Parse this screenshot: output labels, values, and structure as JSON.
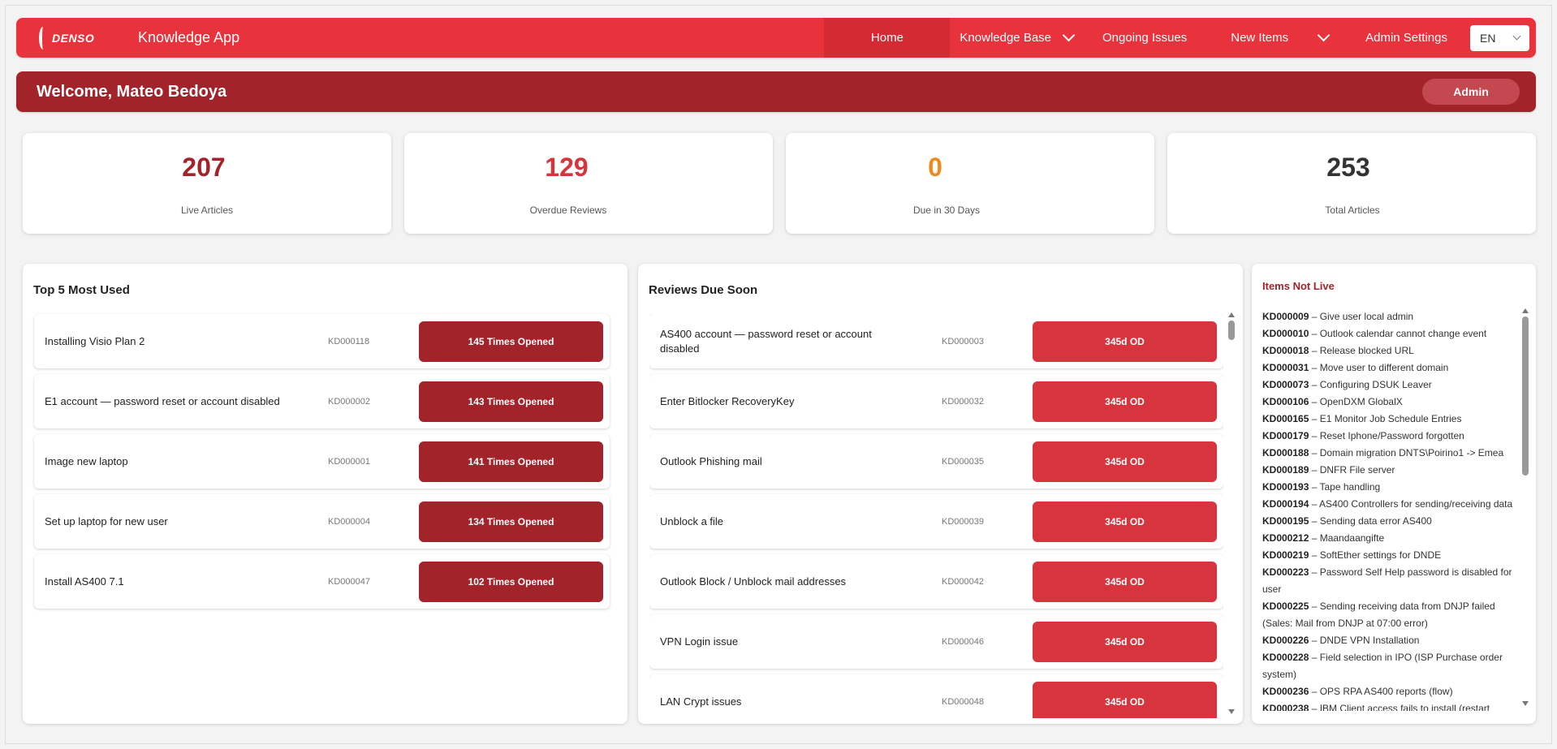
{
  "nav": {
    "logo_text": "DENSO",
    "app_title": "Knowledge App",
    "items": [
      "Home",
      "Knowledge Base",
      "Ongoing Issues",
      "New Items",
      "Admin Settings"
    ],
    "language": "EN"
  },
  "welcome": {
    "text": "Welcome, Mateo Bedoya",
    "role": "Admin"
  },
  "stats": [
    {
      "value": "207",
      "label": "Live Articles",
      "color": "#a3232b"
    },
    {
      "value": "129",
      "label": "Overdue Reviews",
      "color": "#d8343d"
    },
    {
      "value": "0",
      "label": "Due in 30 Days",
      "color": "#f0891a"
    },
    {
      "value": "253",
      "label": "Total Articles",
      "color": "#333333"
    }
  ],
  "top_used": {
    "title": "Top 5 Most Used",
    "rows": [
      {
        "title": "Installing Visio Plan 2",
        "id": "KD000118",
        "badge": "145 Times Opened"
      },
      {
        "title": "E1 account — password reset or account disabled",
        "id": "KD000002",
        "badge": "143 Times Opened"
      },
      {
        "title": "Image new laptop",
        "id": "KD000001",
        "badge": "141 Times Opened"
      },
      {
        "title": "Set up laptop for new user",
        "id": "KD000004",
        "badge": "134 Times Opened"
      },
      {
        "title": "Install AS400 7.1",
        "id": "KD000047",
        "badge": "102 Times Opened"
      }
    ]
  },
  "reviews_due": {
    "title": "Reviews Due Soon",
    "rows": [
      {
        "title": "AS400 account — password reset or account disabled",
        "id": "KD000003",
        "badge": "345d OD"
      },
      {
        "title": "Enter Bitlocker RecoveryKey",
        "id": "KD000032",
        "badge": "345d OD"
      },
      {
        "title": "Outlook Phishing mail",
        "id": "KD000035",
        "badge": "345d OD"
      },
      {
        "title": "Unblock a file",
        "id": "KD000039",
        "badge": "345d OD"
      },
      {
        "title": "Outlook Block / Unblock mail addresses",
        "id": "KD000042",
        "badge": "345d OD"
      },
      {
        "title": "VPN Login issue",
        "id": "KD000046",
        "badge": "345d OD"
      },
      {
        "title": "LAN Crypt issues",
        "id": "KD000048",
        "badge": "345d OD"
      }
    ]
  },
  "not_live": {
    "title": "Items Not Live",
    "items": [
      {
        "id": "KD000009",
        "text": "Give user local admin"
      },
      {
        "id": "KD000010",
        "text": "Outlook calendar cannot change event"
      },
      {
        "id": "KD000018",
        "text": "Release blocked URL"
      },
      {
        "id": "KD000031",
        "text": "Move user to different domain"
      },
      {
        "id": "KD000073",
        "text": "Configuring DSUK Leaver"
      },
      {
        "id": "KD000106",
        "text": "OpenDXM GlobalX"
      },
      {
        "id": "KD000165",
        "text": "E1 Monitor Job Schedule Entries"
      },
      {
        "id": "KD000179",
        "text": "Reset Iphone/Password forgotten"
      },
      {
        "id": "KD000188",
        "text": "Domain migration DNTS\\Poirino1 -> Emea"
      },
      {
        "id": "KD000189",
        "text": "DNFR File server"
      },
      {
        "id": "KD000193",
        "text": "Tape handling"
      },
      {
        "id": "KD000194",
        "text": "AS400 Controllers for sending/receiving data"
      },
      {
        "id": "KD000195",
        "text": "Sending data error AS400"
      },
      {
        "id": "KD000212",
        "text": "Maandaangifte"
      },
      {
        "id": "KD000219",
        "text": "SoftEther settings for DNDE"
      },
      {
        "id": "KD000223",
        "text": "Password Self Help password is disabled for user"
      },
      {
        "id": "KD000225",
        "text": "Sending receiving data from DNJP failed (Sales: Mail from DNJP at 07:00 error)"
      },
      {
        "id": "KD000226",
        "text": "DNDE VPN Installation"
      },
      {
        "id": "KD000228",
        "text": "Field selection in IPO (ISP Purchase order system)"
      },
      {
        "id": "KD000236",
        "text": "OPS RPA AS400 reports (flow)"
      },
      {
        "id": "KD000238",
        "text": "IBM Client access fails to install (restart"
      }
    ]
  },
  "separator": " – "
}
